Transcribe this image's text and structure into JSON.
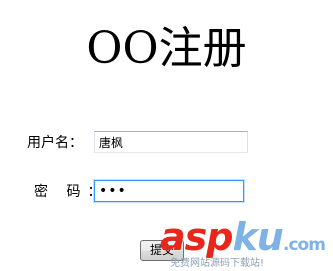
{
  "title": "OO注册",
  "form": {
    "username_label": "用户名：",
    "username_value": "唐枫",
    "password_label": "密 码：",
    "password_value": "123",
    "submit_label": "提交"
  },
  "watermark": {
    "logo_part1": "asp",
    "logo_part2": "ku",
    "logo_tld": ".com",
    "tagline": "免费网站源码下载站!",
    "colors": {
      "primary": "#e8261c",
      "secondary": "#7fb3e6"
    }
  }
}
